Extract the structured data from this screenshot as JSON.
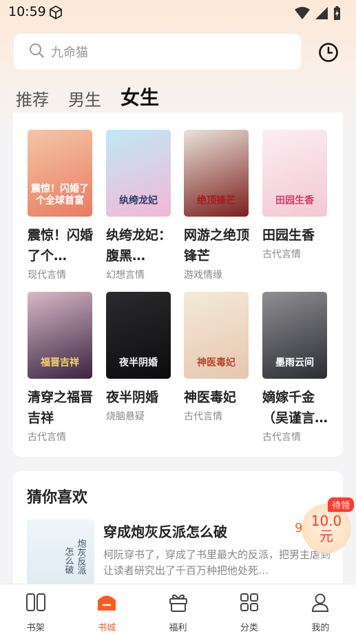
{
  "status_bar": {
    "time": "10:59"
  },
  "search": {
    "placeholder": "九命猫"
  },
  "tabs": [
    {
      "label": "推荐",
      "active": false
    },
    {
      "label": "男生",
      "active": false
    },
    {
      "label": "女生",
      "active": true
    }
  ],
  "books": [
    {
      "title": "震惊！闪婚了个全球首富",
      "title_display": "震惊！闪婚了个…",
      "category": "现代言情",
      "cover_text": "震惊！闪婚了个全球首富",
      "cover_colors": [
        "#f5c6a5",
        "#e87b62"
      ],
      "cover_text_color": "#fff"
    },
    {
      "title": "纨绔龙妃：腹黑…",
      "category": "幻想言情",
      "cover_text": "纨绔龙妃",
      "cover_colors": [
        "#bfe9f6",
        "#f3b7d5"
      ],
      "cover_text_color": "#2a3b6b"
    },
    {
      "title": "网游之绝顶锋芒",
      "category": "游戏情缘",
      "cover_text": "绝顶锋芒",
      "cover_colors": [
        "#e9e3dc",
        "#7a1f1c"
      ],
      "cover_text_color": "#a51c1c"
    },
    {
      "title": "田园生香",
      "category": "古代言情",
      "cover_text": "田园生香",
      "cover_colors": [
        "#fbeef2",
        "#f3c7d4"
      ],
      "cover_text_color": "#d23d6a"
    },
    {
      "title": "清穿之福晋吉祥",
      "category": "古代言情",
      "cover_text": "福晋吉祥",
      "cover_colors": [
        "#d8b8c6",
        "#3a2442"
      ],
      "cover_text_color": "#f7d36b"
    },
    {
      "title": "夜半阴婚",
      "category": "烧脑悬疑",
      "cover_text": "夜半阴婚",
      "cover_colors": [
        "#2b2b2f",
        "#0c0c0e"
      ],
      "cover_text_color": "#f2f2f2"
    },
    {
      "title": "神医毒妃",
      "category": "古代言情",
      "cover_text": "神医毒妃",
      "cover_colors": [
        "#f4ead9",
        "#e6c6ae"
      ],
      "cover_text_color": "#b8452e"
    },
    {
      "title": "嫡嫁千金（吴谨言…",
      "category": "古代言情",
      "cover_text": "墨雨云间",
      "cover_colors": [
        "#8f8f93",
        "#2c2d33"
      ],
      "cover_text_color": "#ffffff"
    }
  ],
  "guess": {
    "section_title": "猜你喜欢",
    "book_title": "穿成炮灰反派怎么破",
    "score": "9",
    "description": "柯阮穿书了，穿成了书里最大的反派，把男主虐到让读者研究出了千百万种把他处死…",
    "cover_text": "怎么破"
  },
  "reward": {
    "badge": "待领",
    "amount": "10.0",
    "unit": "元"
  },
  "bottom_nav": [
    {
      "label": "书架",
      "icon": "bookshelf-icon",
      "active": false
    },
    {
      "label": "书城",
      "icon": "bookstore-icon",
      "active": true
    },
    {
      "label": "福利",
      "icon": "gift-icon",
      "active": false
    },
    {
      "label": "分类",
      "icon": "category-icon",
      "active": false
    },
    {
      "label": "我的",
      "icon": "profile-icon",
      "active": false
    }
  ],
  "colors": {
    "accent": "#ff5a1f",
    "badge": "#ff3b30"
  }
}
